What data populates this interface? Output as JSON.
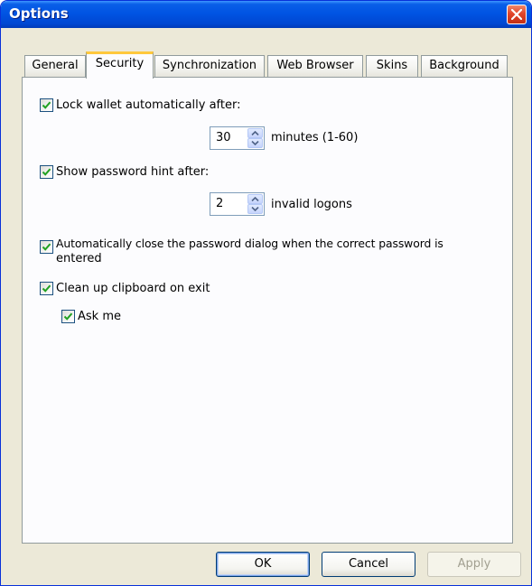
{
  "window": {
    "title": "Options"
  },
  "tabs": [
    {
      "label": "General"
    },
    {
      "label": "Security"
    },
    {
      "label": "Synchronization"
    },
    {
      "label": "Web Browser"
    },
    {
      "label": "Skins"
    },
    {
      "label": "Background"
    }
  ],
  "security": {
    "lock_wallet": {
      "label": "Lock wallet automatically after:",
      "checked": true
    },
    "lock_minutes": {
      "value": "30",
      "suffix": "minutes (1-60)"
    },
    "password_hint": {
      "label": "Show password hint after:",
      "checked": true
    },
    "hint_logons": {
      "value": "2",
      "suffix": "invalid logons"
    },
    "auto_close": {
      "label_line1": "Automatically close the password dialog when the correct password is",
      "label_line2": "entered",
      "checked": true
    },
    "clean_clipboard": {
      "label": "Clean up clipboard on exit",
      "checked": true
    },
    "ask_me": {
      "label": "Ask me",
      "checked": true
    }
  },
  "buttons": {
    "ok": "OK",
    "cancel": "Cancel",
    "apply": "Apply"
  },
  "colors": {
    "titlebar": "#0054e3",
    "dialog_bg": "#ece9d8",
    "active_tab_highlight": "#ffc83c",
    "check": "#21a121"
  }
}
